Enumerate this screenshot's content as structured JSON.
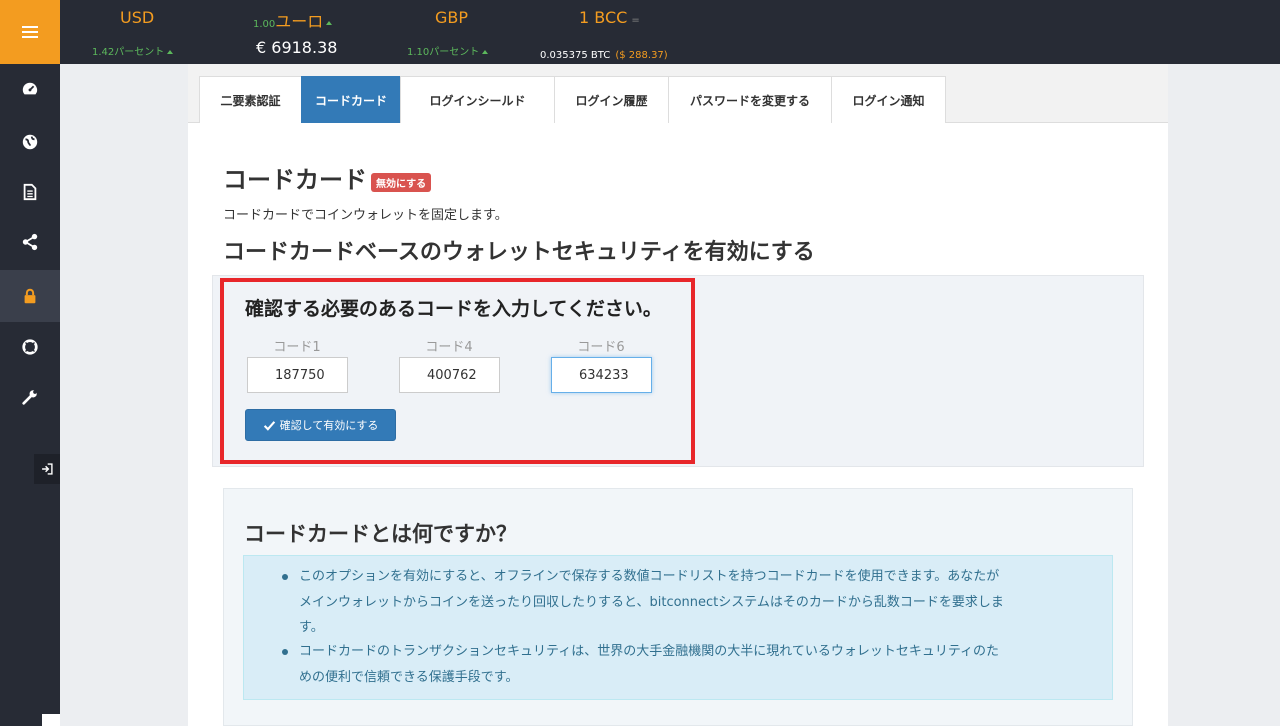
{
  "ticker": {
    "usd": {
      "label": "USD",
      "change": "1.42パーセント"
    },
    "jpy": {
      "rate": "1.00",
      "label": "ユーロ",
      "value": "€ 6918.38"
    },
    "gbp": {
      "label": "GBP",
      "change": "1.10パーセント"
    },
    "bcc": {
      "label": "1 BCC",
      "eq": "=",
      "btc": "0.035375 BTC",
      "usd": "($ 288.37)"
    }
  },
  "sidebar": {
    "items": [
      {
        "icon": "dashboard-icon"
      },
      {
        "icon": "globe-icon"
      },
      {
        "icon": "document-icon"
      },
      {
        "icon": "share-icon"
      },
      {
        "icon": "lock-icon",
        "active": true
      },
      {
        "icon": "lifebuoy-icon"
      },
      {
        "icon": "wrench-icon"
      }
    ],
    "logout_icon": "logout-icon"
  },
  "tabs": [
    {
      "label": "二要素認証"
    },
    {
      "label": "コードカード",
      "active": true
    },
    {
      "label": "ログインシールド"
    },
    {
      "label": "ログイン履歴"
    },
    {
      "label": "パスワードを変更する"
    },
    {
      "label": "ログイン通知"
    }
  ],
  "page": {
    "title": "コードカード",
    "badge": "無効にする",
    "description": "コードカードでコインウォレットを固定します。",
    "subtitle": "コードカードベースのウォレットセキュリティを有効にする"
  },
  "form": {
    "title": "確認する必要のあるコードを入力してください。",
    "codes": [
      {
        "label": "コード1",
        "value": "187750"
      },
      {
        "label": "コード4",
        "value": "400762"
      },
      {
        "label": "コード6",
        "value": "634233"
      }
    ],
    "button": "確認して有効にする"
  },
  "info": {
    "title": "コードカードとは何ですか？",
    "items": [
      {
        "lines": [
          "このオプションを有効にすると、オフラインで保存する数値コードリストを持つコードカードを使用できます。あなたが",
          "メインウォレットからコインを送ったり回収したりすると、bitconnectシステムはそのカードから乱数コードを要求しま",
          "す。"
        ]
      },
      {
        "lines": [
          "コードカードのトランザクションセキュリティは、世界の大手金融機関の大半に現れているウォレットセキュリティのた",
          "めの便利で信頼できる保護手段です。"
        ]
      }
    ]
  },
  "colors": {
    "accent": "#f39c20",
    "primary": "#337ab7",
    "danger": "#d9534f",
    "highlight": "#e8262a",
    "sidebar": "#272b35"
  }
}
